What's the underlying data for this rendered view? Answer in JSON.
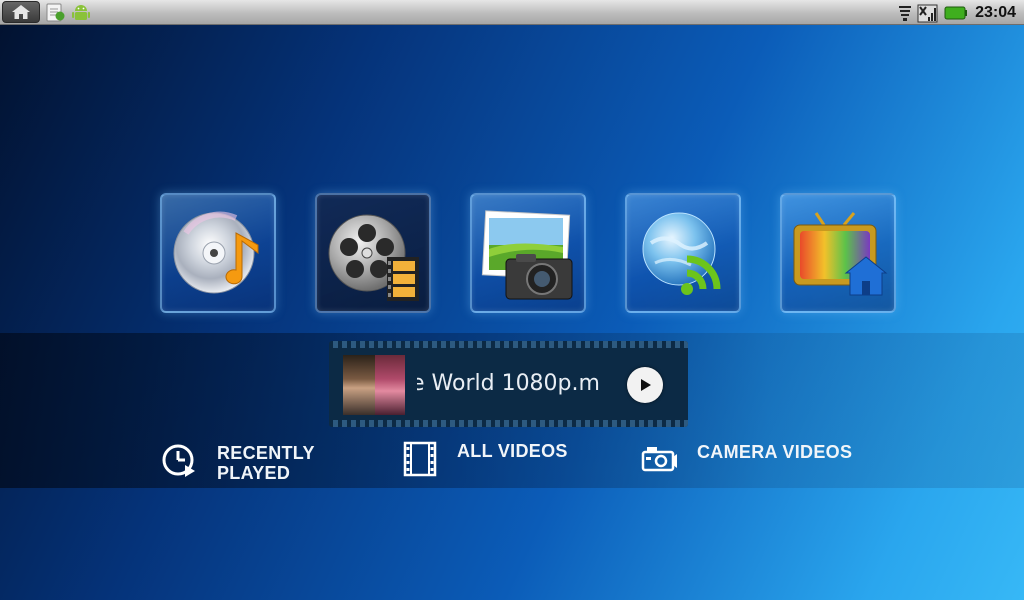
{
  "status_bar": {
    "time": "23:04",
    "icons": [
      "home-icon",
      "notes-notification-icon",
      "android-notification-icon",
      "wifi-icon",
      "signal-icon",
      "battery-icon"
    ]
  },
  "apps": [
    {
      "name": "music",
      "icon": "music-disc-icon"
    },
    {
      "name": "videos",
      "icon": "film-reel-icon",
      "selected": true
    },
    {
      "name": "photos",
      "icon": "photo-camera-icon"
    },
    {
      "name": "network",
      "icon": "globe-rss-icon"
    },
    {
      "name": "tv-home",
      "icon": "tv-home-icon"
    }
  ],
  "now_playing": {
    "title": "e World 1080p.m"
  },
  "nav": {
    "recently_played": "RECENTLY PLAYED",
    "all_videos": "ALL VIDEOS",
    "camera_videos": "CAMERA VIDEOS"
  },
  "colors": {
    "battery": "#3fae1e",
    "background_dark": "#02112e",
    "background_light": "#37b8f6"
  }
}
